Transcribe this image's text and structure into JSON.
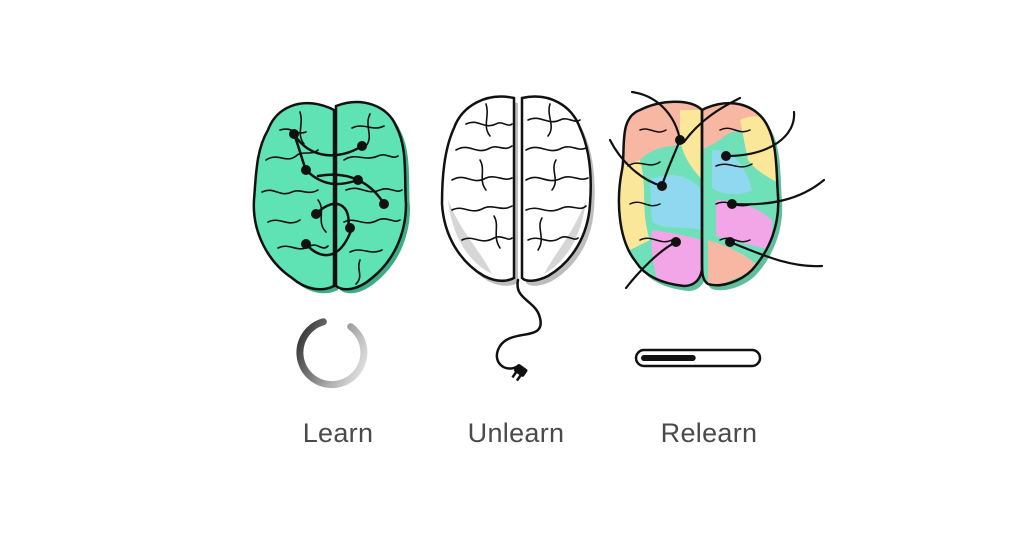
{
  "panels": [
    {
      "label": "Learn",
      "indicator": "loading-spinner-icon"
    },
    {
      "label": "Unlearn",
      "indicator": "unplugged-cord-icon"
    },
    {
      "label": "Relearn",
      "indicator": "progress-bar",
      "progress": 0.48
    }
  ],
  "colors": {
    "learn_brain": "#5fe3b4",
    "unlearn_brain": "#ffffff",
    "relearn_patches": [
      "#f7b7a3",
      "#fbe79a",
      "#8fd8f0",
      "#f2a6e8",
      "#6fe0b8"
    ],
    "outline": "#111111",
    "label_text": "#4a4a4a"
  }
}
